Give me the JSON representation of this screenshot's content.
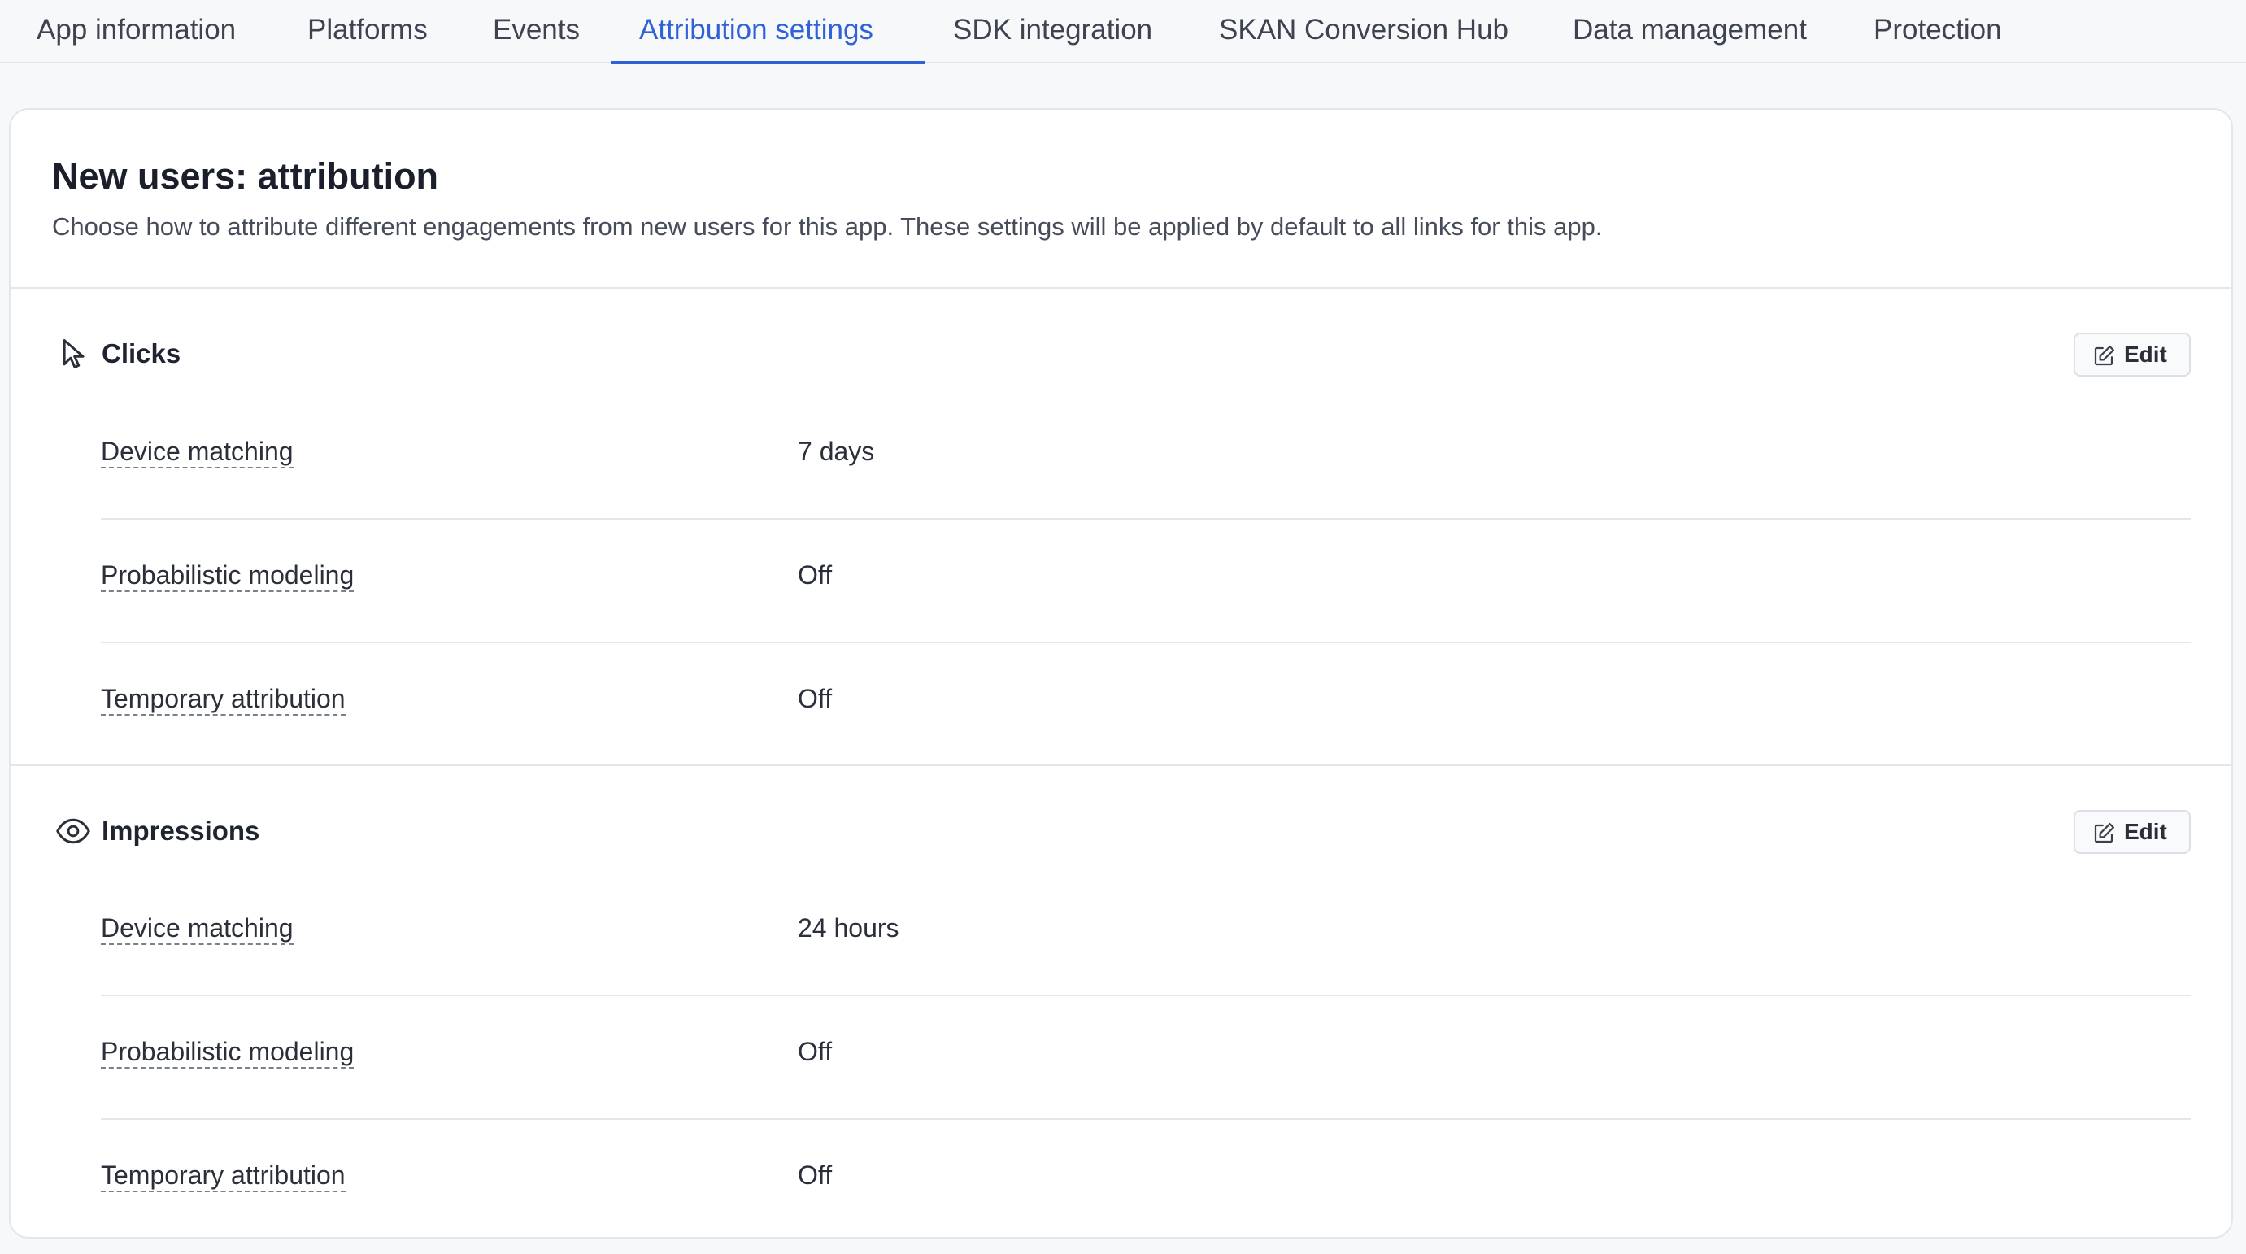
{
  "tabs": [
    {
      "label": "App information"
    },
    {
      "label": "Platforms"
    },
    {
      "label": "Events"
    },
    {
      "label": "Attribution settings",
      "active": true
    },
    {
      "label": "SDK integration"
    },
    {
      "label": "SKAN Conversion Hub"
    },
    {
      "label": "Data management"
    },
    {
      "label": "Protection"
    }
  ],
  "card": {
    "title": "New users: attribution",
    "description": "Choose how to attribute different engagements from new users for this app. These settings will be applied by default to all links for this app."
  },
  "sections": [
    {
      "title": "Clicks",
      "icon": "cursor-arrow-icon",
      "edit_label": "Edit",
      "rows": [
        {
          "label": "Device matching",
          "value": "7 days"
        },
        {
          "label": "Probabilistic modeling",
          "value": "Off"
        },
        {
          "label": "Temporary attribution",
          "value": "Off"
        }
      ]
    },
    {
      "title": "Impressions",
      "icon": "eye-icon",
      "edit_label": "Edit",
      "rows": [
        {
          "label": "Device matching",
          "value": "24 hours"
        },
        {
          "label": "Probabilistic modeling",
          "value": "Off"
        },
        {
          "label": "Temporary attribution",
          "value": "Off"
        }
      ]
    }
  ],
  "colors": {
    "accent": "#2f62d6",
    "text": "#1f2430",
    "border": "#e3e6eb",
    "background": "#f7f8fa"
  }
}
